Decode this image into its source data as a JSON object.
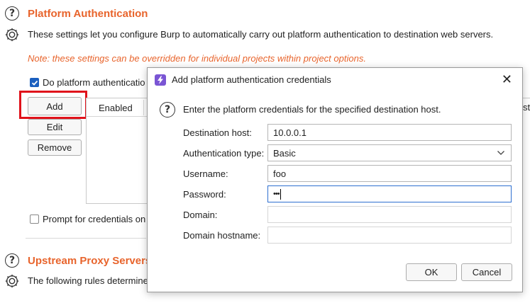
{
  "platform_auth": {
    "title": "Platform Authentication",
    "description": "These settings let you configure Burp to automatically carry out platform authentication to destination web servers.",
    "note": "Note: these settings can be overridden for individual projects within project options.",
    "do_platform_auth_label": "Do platform authenticatio",
    "buttons": {
      "add": "Add",
      "edit": "Edit",
      "remove": "Remove"
    },
    "table": {
      "col_enabled": "Enabled",
      "col_partial": "st"
    },
    "prompt_label": "Prompt for credentials on"
  },
  "upstream": {
    "title": "Upstream Proxy Servers",
    "description": "The following rules determine"
  },
  "dialog": {
    "title": "Add platform authentication credentials",
    "app_icon": "burp-lightning-icon",
    "intro": "Enter the platform credentials for the specified destination host.",
    "fields": {
      "destination_host": {
        "label": "Destination host:",
        "value": "10.0.0.1"
      },
      "auth_type": {
        "label": "Authentication type:",
        "value": "Basic"
      },
      "username": {
        "label": "Username:",
        "value": "foo"
      },
      "password": {
        "label": "Password:",
        "value": "•••"
      },
      "domain": {
        "label": "Domain:",
        "value": ""
      },
      "domain_hostname": {
        "label": "Domain hostname:",
        "value": ""
      }
    },
    "ok": "OK",
    "cancel": "Cancel"
  },
  "colors": {
    "accent": "#e8642c",
    "highlight": "#e0121b",
    "focus": "#2d6fd0"
  }
}
